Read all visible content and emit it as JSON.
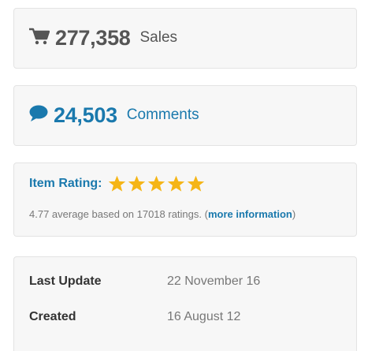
{
  "sales": {
    "number": "277,358",
    "label": "Sales",
    "icon": "cart-icon",
    "color": "#555555"
  },
  "comments": {
    "number": "24,503",
    "label": "Comments",
    "icon": "speech-bubble-icon",
    "color": "#1a79ad"
  },
  "rating": {
    "title": "Item Rating:",
    "stars_filled": 5,
    "stars_total": 5,
    "star_color": "#f5b516",
    "text_prefix": "4.77 average based on 17018 ratings. (",
    "link_text": "more information",
    "text_suffix": ")"
  },
  "meta": {
    "last_update_label": "Last Update",
    "last_update_value": "22 November 16",
    "created_label": "Created",
    "created_value": "16 August 12"
  }
}
